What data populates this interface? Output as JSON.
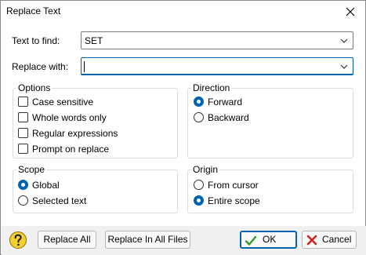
{
  "dialog": {
    "title": "Replace Text"
  },
  "find": {
    "label": "Text to find:",
    "value": "SET"
  },
  "replace": {
    "label": "Replace with:",
    "value": ""
  },
  "options": {
    "title": "Options",
    "items": [
      {
        "label": "Case sensitive",
        "checked": false
      },
      {
        "label": "Whole words only",
        "checked": false
      },
      {
        "label": "Regular expressions",
        "checked": false
      },
      {
        "label": "Prompt on replace",
        "checked": false
      }
    ]
  },
  "direction": {
    "title": "Direction",
    "items": [
      {
        "label": "Forward",
        "selected": true
      },
      {
        "label": "Backward",
        "selected": false
      }
    ]
  },
  "scope": {
    "title": "Scope",
    "items": [
      {
        "label": "Global",
        "selected": true
      },
      {
        "label": "Selected text",
        "selected": false
      }
    ]
  },
  "origin": {
    "title": "Origin",
    "items": [
      {
        "label": "From cursor",
        "selected": false
      },
      {
        "label": "Entire scope",
        "selected": true
      }
    ]
  },
  "buttons": {
    "replace_all": "Replace All",
    "replace_in_all_files": "Replace In All Files",
    "ok": "OK",
    "cancel": "Cancel"
  },
  "icons": {
    "help": "help-question-icon",
    "ok": "checkmark-icon",
    "cancel": "cross-icon",
    "close": "close-icon",
    "dropdown": "chevron-down-icon"
  },
  "colors": {
    "accent": "#0063b1",
    "ok_check": "#2e9e2e",
    "cancel_x": "#d42020",
    "help_bg": "#f2d030"
  }
}
